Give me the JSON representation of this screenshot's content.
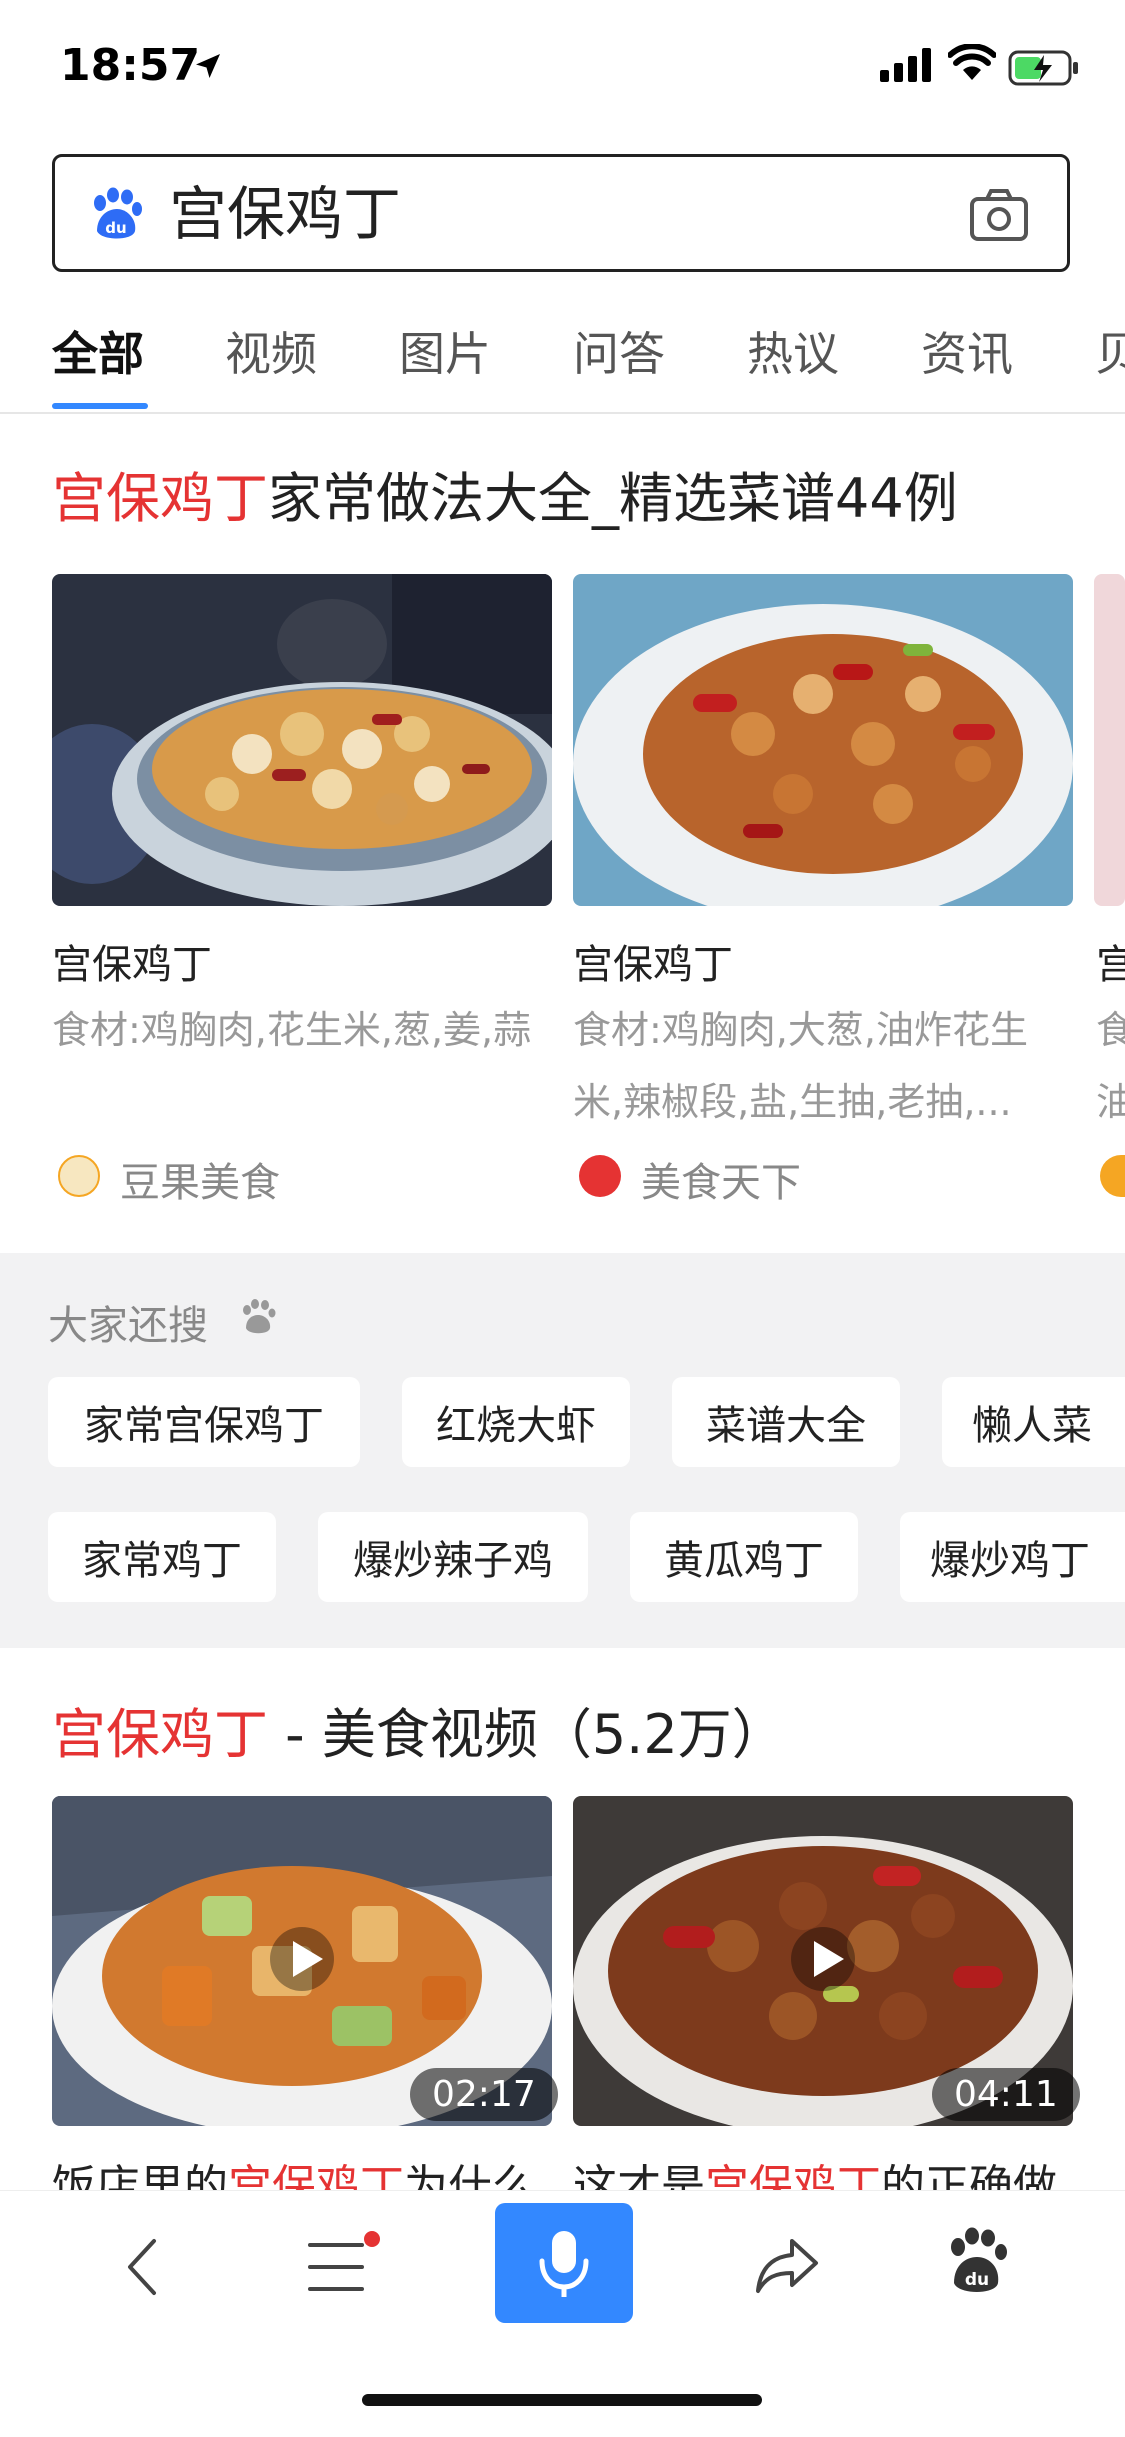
{
  "status": {
    "time": "18:57"
  },
  "search": {
    "query": "宫保鸡丁"
  },
  "tabs": [
    {
      "label": "全部",
      "active": true
    },
    {
      "label": "视频"
    },
    {
      "label": "图片"
    },
    {
      "label": "问答"
    },
    {
      "label": "热议"
    },
    {
      "label": "资讯"
    },
    {
      "label": "贝"
    }
  ],
  "recipes": {
    "title_highlight": "宫保鸡丁",
    "title_rest": "家常做法大全_精选菜谱44例",
    "cards": [
      {
        "name": "宫保鸡丁",
        "desc": "食材:鸡胸肉,花生米,葱,姜,蒜",
        "source": "豆果美食",
        "logo_text": "豆果\n美食",
        "logo_color": "#f5a623"
      },
      {
        "name": "宫保鸡丁",
        "desc": "食材:鸡胸肉,大葱,油炸花生米,辣椒段,盐,生抽,老抽,...",
        "source": "美食天下",
        "logo_text": "美食\n天下",
        "logo_color": "#e53333"
      },
      {
        "name": "宫",
        "desc": "食\n油",
        "source": ""
      }
    ]
  },
  "also_search": {
    "title": "大家还搜",
    "row1": [
      "家常宫保鸡丁",
      "红烧大虾",
      "菜谱大全",
      "懒人菜"
    ],
    "row2": [
      "家常鸡丁",
      "爆炒辣子鸡",
      "黄瓜鸡丁",
      "爆炒鸡丁"
    ]
  },
  "videos": {
    "title_highlight": "宫保鸡丁",
    "title_rest": " - 美食视频（5.2万）",
    "items": [
      {
        "duration": "02:17",
        "caption_pre": "饭店里的",
        "caption_hl": "宫保鸡丁",
        "caption_post": "为什么"
      },
      {
        "duration": "04:11",
        "caption_pre": "这才是",
        "caption_hl": "宫保鸡丁",
        "caption_post": "的正确做"
      }
    ]
  },
  "colors": {
    "accent": "#3388ff",
    "highlight": "#e53333"
  }
}
